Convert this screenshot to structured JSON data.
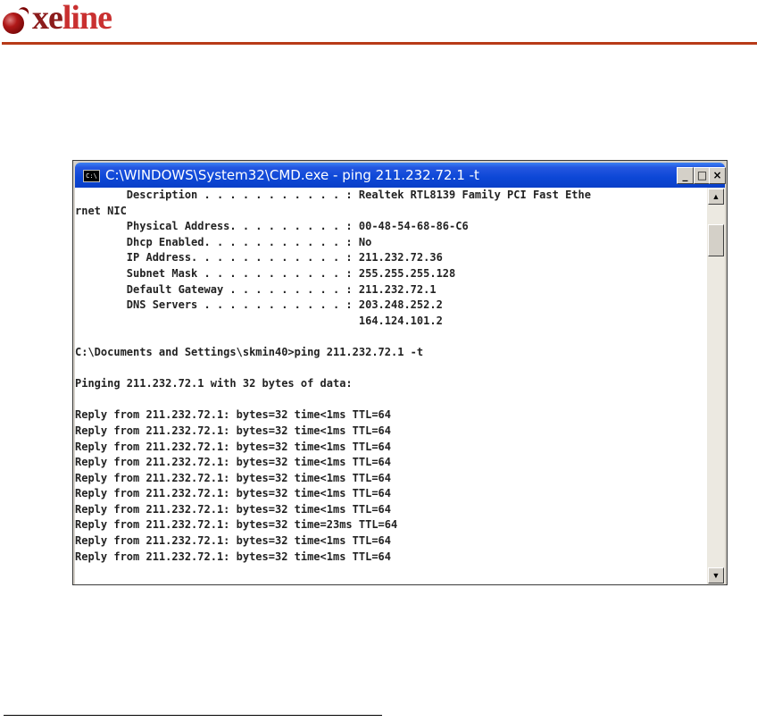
{
  "document": {
    "logo": {
      "prefix": "xe",
      "suffix": "line"
    }
  },
  "window": {
    "title": "C:\\WINDOWS\\System32\\CMD.exe - ping 211.232.72.1 -t",
    "icon_label": "C:\\",
    "buttons": {
      "minimize": "_",
      "maximize": "□",
      "close": "×"
    }
  },
  "console": {
    "lines": [
      "        Description . . . . . . . . . . . : Realtek RTL8139 Family PCI Fast Ethe",
      "rnet NIC",
      "        Physical Address. . . . . . . . . : 00-48-54-68-86-C6",
      "        Dhcp Enabled. . . . . . . . . . . : No",
      "        IP Address. . . . . . . . . . . . : 211.232.72.36",
      "        Subnet Mask . . . . . . . . . . . : 255.255.255.128",
      "        Default Gateway . . . . . . . . . : 211.232.72.1",
      "        DNS Servers . . . . . . . . . . . : 203.248.252.2",
      "                                            164.124.101.2",
      "",
      "C:\\Documents and Settings\\skmin40>ping 211.232.72.1 -t",
      "",
      "Pinging 211.232.72.1 with 32 bytes of data:",
      "",
      "Reply from 211.232.72.1: bytes=32 time<1ms TTL=64",
      "Reply from 211.232.72.1: bytes=32 time<1ms TTL=64",
      "Reply from 211.232.72.1: bytes=32 time<1ms TTL=64",
      "Reply from 211.232.72.1: bytes=32 time<1ms TTL=64",
      "Reply from 211.232.72.1: bytes=32 time<1ms TTL=64",
      "Reply from 211.232.72.1: bytes=32 time<1ms TTL=64",
      "Reply from 211.232.72.1: bytes=32 time<1ms TTL=64",
      "Reply from 211.232.72.1: bytes=32 time=23ms TTL=64",
      "Reply from 211.232.72.1: bytes=32 time<1ms TTL=64",
      "Reply from 211.232.72.1: bytes=32 time<1ms TTL=64"
    ]
  },
  "scrollbar": {
    "up_arrow": "▲",
    "down_arrow": "▼"
  },
  "colors": {
    "title_bar": "#0c47d6",
    "logo_dark": "#8c1c1c",
    "logo_light": "#c93030",
    "header_rule": "#b83a18"
  }
}
